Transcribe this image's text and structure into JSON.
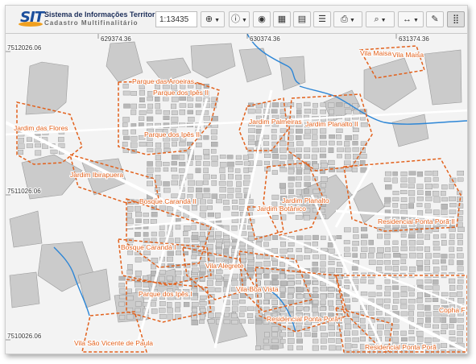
{
  "app": {
    "logo_mark": "SIT",
    "title": "Sistema de Informações Territoriais",
    "subtitle": "Cadastro Multifinalitário"
  },
  "toolbar": {
    "scale_value": "1:13435",
    "buttons": [
      {
        "name": "zoom-menu-button",
        "icon": "zoom-in-icon",
        "glyph": "⊕",
        "dropdown": true
      },
      {
        "name": "info-menu-button",
        "icon": "info-icon",
        "glyph": "ⓘ",
        "dropdown": true
      },
      {
        "name": "visibility-button",
        "icon": "eye-icon",
        "glyph": "◉",
        "dropdown": false
      },
      {
        "name": "grid-view-button",
        "icon": "grid-icon",
        "glyph": "▦",
        "dropdown": false
      },
      {
        "name": "report-button",
        "icon": "document-icon",
        "glyph": "▤",
        "dropdown": false
      },
      {
        "name": "list-button",
        "icon": "list-icon",
        "glyph": "☰",
        "dropdown": false
      },
      {
        "name": "print-menu-button",
        "icon": "print-icon",
        "glyph": "⎙",
        "dropdown": true
      },
      {
        "name": "search-menu-button",
        "icon": "search-icon",
        "glyph": "⌕",
        "dropdown": true
      },
      {
        "name": "measure-menu-button",
        "icon": "measure-icon",
        "glyph": "↔",
        "dropdown": true
      },
      {
        "name": "draw-button",
        "icon": "pencil-icon",
        "glyph": "✎",
        "dropdown": false
      },
      {
        "name": "apps-button",
        "icon": "apps-grid-icon",
        "glyph": "⣿",
        "dropdown": false
      }
    ]
  },
  "map": {
    "coordinates": {
      "x_629374": "629374.36",
      "x_630374": "630374.36",
      "x_631374": "631374.36",
      "y_7512026": "7512026.06",
      "y_7511026": "7511026.06",
      "y_7510026": "7510026.06"
    },
    "labels": {
      "vila_maisa_1": "Vila Maisa",
      "vila_maisa_2": "Vila Maisa",
      "parque_aroeiras": "Parque das Aroeiras",
      "parque_ipes_ii_top": "Parque dos Ipês II",
      "parque_ipes_ii": "Parque dos Ipês II",
      "jardim_flores": "Jardim das Flores",
      "jardim_palmeiras": "Jardim Palmeiras",
      "jardim_planalto_ii": "Jardim Planalto II",
      "jardim_ibirapuera": "Jardim Ibirapuera",
      "bosque_caranda_ii": "Bosque Carandá II",
      "jardim_planalto": "Jardim Planalto",
      "jardim_botanico": "Jardim Botânico",
      "residencial_ponta_pora_ii": "Residencial Ponta Porã II",
      "bosque_caranda_i": "Bosque Carandá I",
      "vila_alegrete": "Vila Alegrete",
      "vila_boa_vista": "Vila Boa Vista",
      "parque_ipes_i": "Parque dos Ipês I",
      "residencial_ponta_pora_i": "Residencial Ponta Porã I",
      "copha": "Copha F",
      "vila_sao_vicente": "Vila São Vicente de Paula",
      "residencial_ponta_pora_bottom": "Residencial Ponta Porã"
    },
    "colors": {
      "boundary": "#e2611c",
      "river": "#2d86d6",
      "parcel": "#c9c9c9",
      "parcel_edge": "#9a9a9a",
      "street": "#ffffff",
      "background": "#f3f3f3"
    }
  }
}
